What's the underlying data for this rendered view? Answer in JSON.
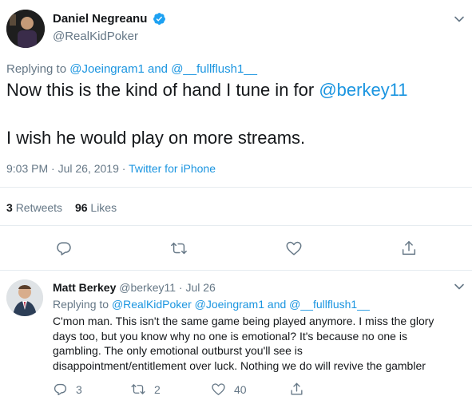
{
  "main_tweet": {
    "author_name": "Daniel Negreanu",
    "author_handle": "@RealKidPoker",
    "replying_prefix": "Replying to",
    "replying_user1": "@Joeingram1",
    "replying_and": "and",
    "replying_user2": "@__fullflush1__",
    "text_line1_prefix": "Now this is the kind of hand I tune in for",
    "text_line1_mention": "@berkey11",
    "text_line2": "I wish he would play on more streams.",
    "timestamp": "9:03 PM · Jul 26, 2019 ·",
    "source": "Twitter for iPhone",
    "retweets_count": "3",
    "retweets_label": "Retweets",
    "likes_count": "96",
    "likes_label": "Likes"
  },
  "reply_tweet": {
    "author_name": "Matt Berkey",
    "author_handle": "@berkey11",
    "date": "· Jul 26",
    "replying_prefix": "Replying to",
    "replying_users": "@RealKidPoker @Joeingram1",
    "replying_and": "and",
    "replying_user3": "@__fullflush1__",
    "text_lines": [
      "C'mon man. This isn't the same game being played anymore. I miss the glory",
      "days too, but you know why no one is emotional? It's because no one is",
      "gambling. The only emotional outburst you'll see is",
      "disappointment/entitlement over luck. Nothing we do will revive the gambler"
    ],
    "reply_count": "3",
    "retweet_count": "2",
    "like_count": "40"
  },
  "colors": {
    "link_blue": "#1b95e0",
    "verified_blue": "#1da1f2",
    "secondary_gray": "#657786",
    "divider": "#e6ecf0"
  },
  "icons": {
    "verified": "verified-badge-icon",
    "chevron": "chevron-down-icon",
    "reply": "reply-icon",
    "retweet": "retweet-icon",
    "like": "heart-icon",
    "share": "share-icon"
  }
}
